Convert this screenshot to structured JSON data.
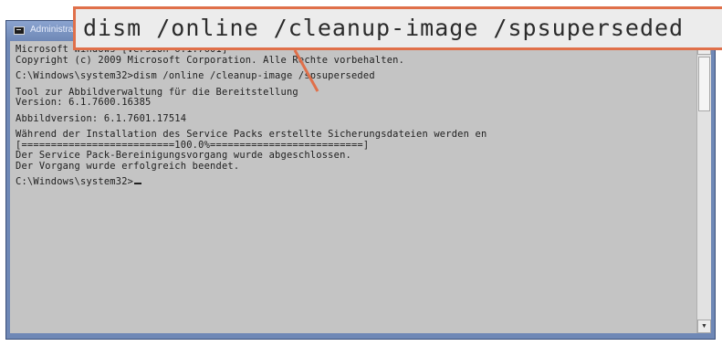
{
  "window": {
    "title": "Administrator: Eingabeaufforderung",
    "icon": "console-icon"
  },
  "callout": {
    "text": "dism /online /cleanup-image /spsuperseded"
  },
  "console": {
    "lines": [
      "Microsoft Windows [Version 6.1.7601]",
      "Copyright (c) 2009 Microsoft Corporation. Alle Rechte vorbehalten.",
      "",
      "C:\\Windows\\system32>dism /online /cleanup-image /spsuperseded",
      "",
      "Tool zur Abbildverwaltung für die Bereitstellung",
      "Version: 6.1.7600.16385",
      "",
      "Abbildversion: 6.1.7601.17514",
      "",
      "Während der Installation des Service Packs erstellte Sicherungsdateien werden en",
      "[==========================100.0%==========================]",
      "Der Service Pack-Bereinigungsvorgang wurde abgeschlossen.",
      "Der Vorgang wurde erfolgreich beendet.",
      ""
    ],
    "prompt": "C:\\Windows\\system32>"
  },
  "colors": {
    "console_bg": "#c4c4c4",
    "console_text": "#202020",
    "window_frame": "#6f88b6",
    "callout_border": "#e0704a"
  }
}
